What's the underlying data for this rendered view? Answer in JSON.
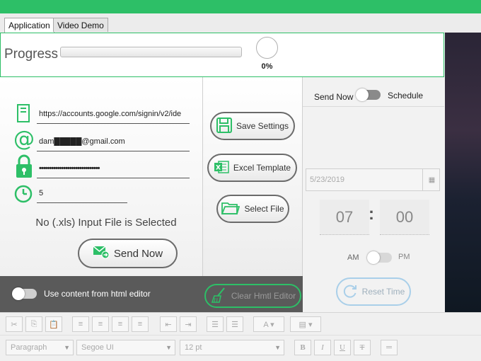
{
  "tabs": [
    {
      "label": "Application",
      "active": true
    },
    {
      "label": "Video Demo",
      "active": false
    }
  ],
  "progress": {
    "label": "Progress",
    "percent_text": "0%",
    "value": 0
  },
  "fields": {
    "url": "https://accounts.google.com/signin/v2/ide",
    "email": "dam█████@gmail.com",
    "password": "••••••••••••••••••••••••••••••",
    "interval": "5"
  },
  "file_status": "No (.xls) Input File is Selected",
  "buttons": {
    "send_now": "Send Now",
    "save_settings": "Save Settings",
    "excel_template": "Excel Template",
    "select_file": "Select File",
    "clear_html": "Clear Hmtl Editor",
    "reset_time": "Reset Time"
  },
  "html_toggle": {
    "label": "Use content from html editor",
    "on": false
  },
  "schedule": {
    "send_now_label": "Send Now",
    "schedule_label": "Schedule",
    "date_placeholder": "5/23/2019",
    "hour": "07",
    "minute": "00",
    "am_label": "AM",
    "pm_label": "PM"
  },
  "editor_toolbar": {
    "paragraph": "Paragraph",
    "font": "Segoe UI",
    "size": "12 pt",
    "bold": "B",
    "italic": "I",
    "underline": "U",
    "strike": "T"
  },
  "colors": {
    "accent": "#2dbf67",
    "panel_dark": "#5a5a5a",
    "reset_border": "#a9cfe9"
  }
}
